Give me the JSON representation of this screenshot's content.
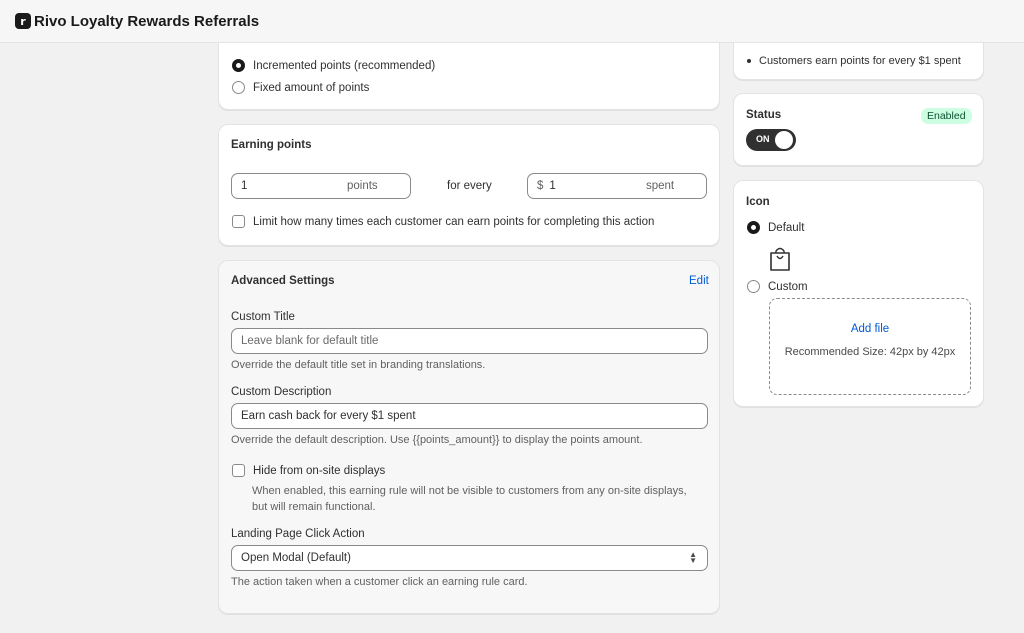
{
  "app": {
    "logo_letter": "r",
    "title": "Rivo Loyalty Rewards Referrals"
  },
  "points_type": {
    "options": [
      {
        "label": "Incremented points (recommended)",
        "checked": true
      },
      {
        "label": "Fixed amount of points",
        "checked": false
      }
    ]
  },
  "earning_points": {
    "title": "Earning points",
    "points_value": "1",
    "points_suffix": "points",
    "for_every": "for every",
    "currency_prefix": "$",
    "spent_value": "1",
    "spent_suffix": "spent",
    "limit_label": "Limit how many times each customer can earn points for completing this action"
  },
  "advanced": {
    "title": "Advanced Settings",
    "edit_label": "Edit",
    "custom_title_label": "Custom Title",
    "custom_title_placeholder": "Leave blank for default title",
    "custom_title_help": "Override the default title set in branding translations.",
    "custom_desc_label": "Custom Description",
    "custom_desc_value": "Earn cash back for every $1 spent",
    "custom_desc_help": "Override the default description. Use {{points_amount}} to display the points amount.",
    "hide_label": "Hide from on-site displays",
    "hide_help_1": "When enabled, this earning rule will not be visible to customers from any on-site displays,",
    "hide_help_2": "but will remain functional.",
    "landing_label": "Landing Page Click Action",
    "landing_value": "Open Modal (Default)",
    "landing_help": "The action taken when a customer click an earning rule card."
  },
  "summary": {
    "bullet": "Customers earn points for every $1 spent"
  },
  "status": {
    "title": "Status",
    "badge": "Enabled",
    "toggle_label": "ON"
  },
  "icon": {
    "title": "Icon",
    "default_label": "Default",
    "custom_label": "Custom",
    "add_file": "Add file",
    "recommended": "Recommended Size: 42px by 42px",
    "default_icon": "shopping-bag-icon"
  },
  "colors": {
    "accent_link": "#005bd3",
    "badge_bg": "#cdfee1",
    "toggle_bg": "#303030"
  }
}
